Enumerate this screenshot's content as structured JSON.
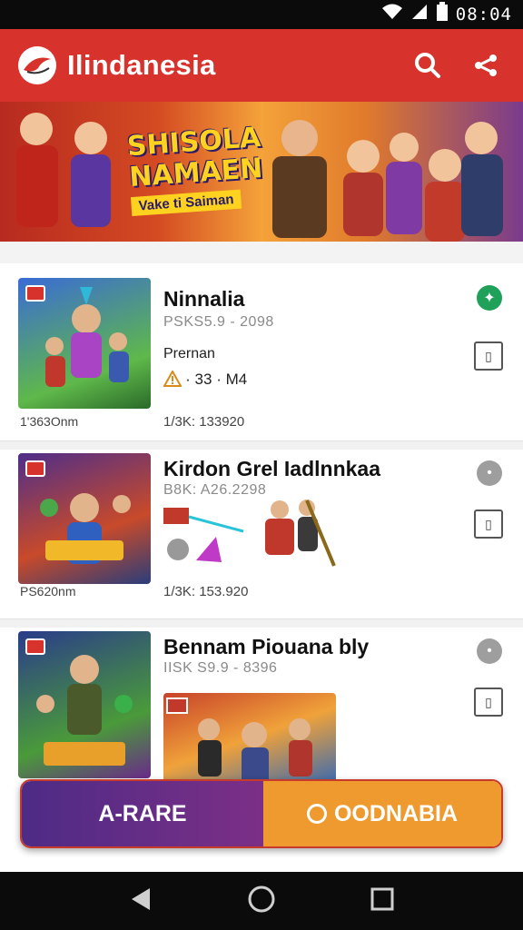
{
  "status_bar": {
    "time": "08:04"
  },
  "app": {
    "title": "Ilindanesia",
    "brand_color": "#d7322b"
  },
  "banner": {
    "line1": "SHISOLA",
    "line2": "NAMAEN",
    "line3": "Vake ti Saiman"
  },
  "items": [
    {
      "name": "Ninnalia",
      "price": "PSKS5.9 - 2098",
      "label": "Prernan",
      "warning": "· 33 · M4",
      "left_meta": "1'363Onm",
      "right_meta": "1/3K: 133920",
      "status_color": "#1fa15a"
    },
    {
      "name": "Kirdon Grel Iadlnnkaa",
      "price": "B8K: A26.2298",
      "left_meta": "PS620nm",
      "right_meta": "1/3K: 153.920",
      "status_color": "#9e9e9e"
    },
    {
      "name": "Bennam Piouana bly",
      "price": "IISK S9.9 - 8396",
      "status_color": "#9e9e9e"
    }
  ],
  "cta": {
    "left_label": "A-RARE",
    "right_label": "OODNABIA"
  },
  "colors": {
    "accent": "#d7322b",
    "cta_left": "#5b2d86",
    "cta_right": "#ef9a2f"
  }
}
